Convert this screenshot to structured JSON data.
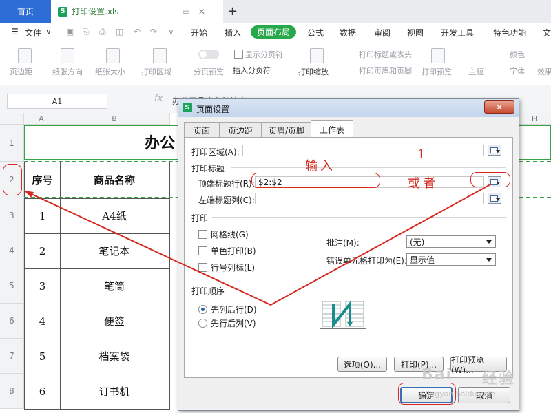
{
  "window": {
    "home_tab": "首页",
    "file_tab": "打印设置.xls",
    "new_tab_glyph": "+"
  },
  "menu": {
    "file_label": "文件",
    "tabs": [
      "开始",
      "插入",
      "页面布局",
      "公式",
      "数据",
      "审阅",
      "视图",
      "开发工具",
      "特色功能",
      "文"
    ],
    "active_tab": "页面布局"
  },
  "ribbon": {
    "margins": "页边距",
    "orientation": "纸张方向",
    "size": "纸张大小",
    "print_area": "打印区域",
    "page_break_preview": "分页预览",
    "show_page_break": "显示分页符",
    "insert_page_break": "插入分页符",
    "print_zoom": "打印缩放",
    "print_titles": "打印标题或表头",
    "print_header_footer": "打印页眉和页脚",
    "print_preview": "打印预览",
    "theme": "主题",
    "colors": "颜色",
    "fonts": "字体",
    "effects": "效果"
  },
  "formula_bar": {
    "name_box": "A1",
    "fx_label": "fx",
    "content": "办公用品库存统计表"
  },
  "sheet": {
    "columns": [
      "A",
      "B",
      "H"
    ],
    "row_numbers": [
      "1",
      "2",
      "3",
      "4",
      "5",
      "6",
      "7",
      "8"
    ],
    "title": "办公",
    "headers": [
      "序号",
      "商品名称"
    ],
    "rows": [
      [
        "1",
        "A4纸"
      ],
      [
        "2",
        "笔记本"
      ],
      [
        "3",
        "笔筒"
      ],
      [
        "4",
        "便签"
      ],
      [
        "5",
        "档案袋"
      ],
      [
        "6",
        "订书机"
      ]
    ]
  },
  "dialog": {
    "title": "页面设置",
    "close_glyph": "✕",
    "tabs": [
      "页面",
      "页边距",
      "页眉/页脚",
      "工作表"
    ],
    "active_tab": "工作表",
    "print_area_label": "打印区域(A):",
    "print_area_value": "",
    "print_titles_section": "打印标题",
    "top_rows_label": "顶端标题行(R):",
    "top_rows_value": "$2:$2",
    "left_cols_label": "左端标题列(C):",
    "left_cols_value": "",
    "print_section": "打印",
    "gridlines": "网格线(G)",
    "mono_print": "单色打印(B)",
    "row_col_headers": "行号列标(L)",
    "comments_label": "批注(M):",
    "comments_value": "(无)",
    "errors_label": "错误单元格打印为(E):",
    "errors_value": "显示值",
    "order_section": "打印顺序",
    "order_down_then_over": "先列后行(D)",
    "order_over_then_down": "先行后列(V)",
    "btn_options": "选项(O)...",
    "btn_print": "打印(P)...",
    "btn_preview": "打印预览(W)...",
    "btn_ok": "确定",
    "btn_cancel": "取消"
  },
  "annotations": {
    "input_text": "输入",
    "number_one": "1",
    "or_text": "或者"
  },
  "watermark": {
    "brand": "Bai",
    "jingyan": "经验",
    "url": "jingyan.baidu.com"
  },
  "colors": {
    "accent_green": "#27a84a",
    "annotation_red": "#d42a21",
    "home_blue": "#2c6ed5"
  }
}
